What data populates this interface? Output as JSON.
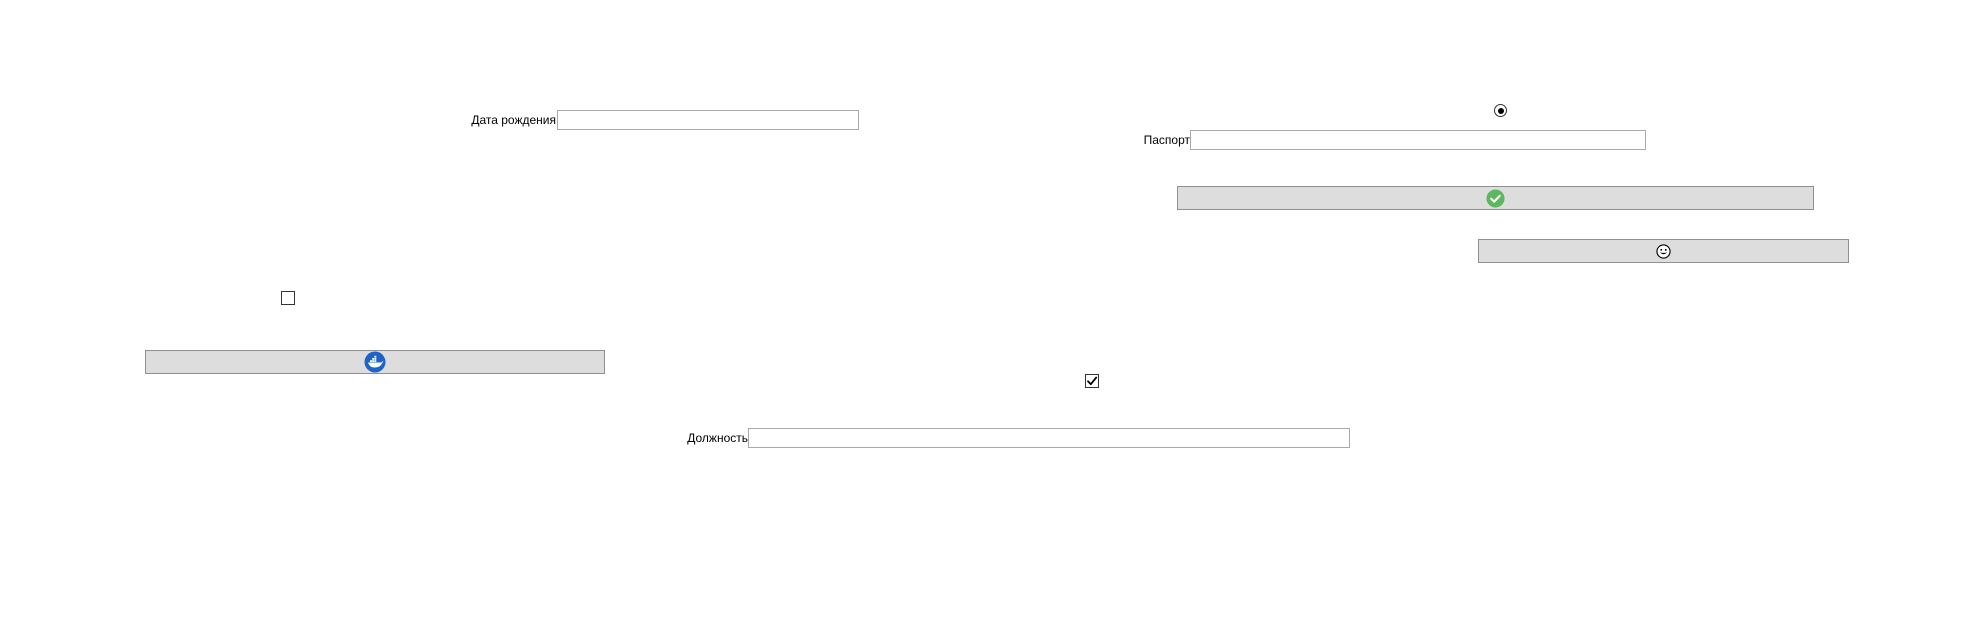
{
  "form": {
    "birth_date": {
      "label": "Дата рождения",
      "value": ""
    },
    "passport": {
      "label": "Паспорт",
      "value": ""
    },
    "position": {
      "label": "Должность",
      "value": ""
    }
  },
  "controls": {
    "radio_top": {
      "checked": true
    },
    "checkbox_left": {
      "checked": false
    },
    "checkbox_center": {
      "checked": true
    }
  },
  "buttons": {
    "confirm": {
      "icon": "green-check-circle-icon"
    },
    "emoji": {
      "icon": "grinning-face-icon"
    },
    "docker": {
      "icon": "docker-whale-icon"
    }
  },
  "colors": {
    "button_bg": "#dddddd",
    "check_green": "#5cb85c",
    "docker_blue": "#1d63c9"
  }
}
